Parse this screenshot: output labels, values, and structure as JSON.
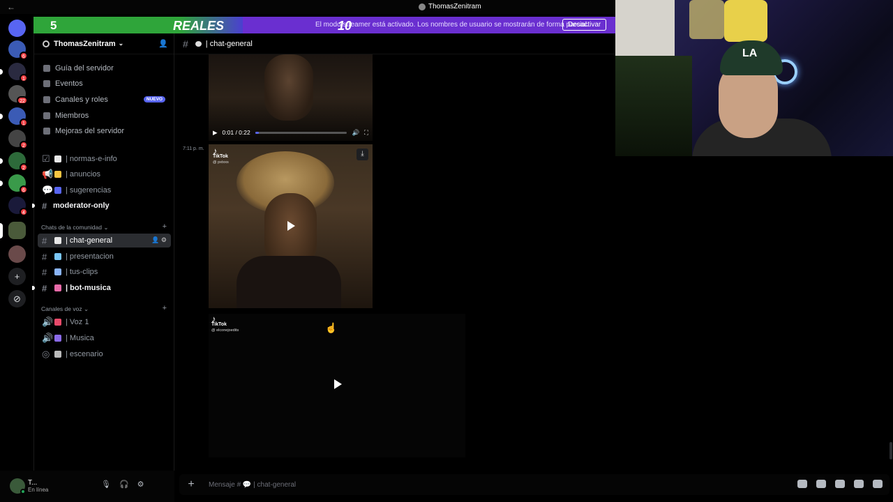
{
  "window": {
    "title": "ThomasZenitram",
    "back_glyph": "←"
  },
  "banner": {
    "left_number": "5",
    "word": "REALES",
    "overlay_number": "10",
    "message": "El modo streamer está activado. Los nombres de usuario se mostrarán de forma parcial.",
    "button": "Desactivar",
    "colors": {
      "green": "#2fa53a",
      "purple": "#6a2fd0"
    }
  },
  "server_list": {
    "items": [
      {
        "name": "discord-home",
        "badge": ""
      },
      {
        "name": "server-1",
        "badge": "6"
      },
      {
        "name": "server-2",
        "badge": "1"
      },
      {
        "name": "server-3",
        "badge": "22"
      },
      {
        "name": "server-4",
        "badge": "1"
      },
      {
        "name": "server-5",
        "badge": "2"
      },
      {
        "name": "server-6",
        "badge": "2"
      },
      {
        "name": "server-7",
        "badge": "6"
      },
      {
        "name": "server-8",
        "badge": "4"
      },
      {
        "name": "server-9",
        "badge": ""
      },
      {
        "name": "server-10",
        "badge": ""
      }
    ],
    "add_glyph": "+",
    "explore_glyph": "⊘"
  },
  "server": {
    "name": "ThomasZenitram",
    "chevron": "⌄",
    "nav": [
      {
        "label": "Guía del servidor",
        "icon": "guide-icon"
      },
      {
        "label": "Eventos",
        "icon": "calendar-icon"
      },
      {
        "label": "Canales y roles",
        "icon": "channels-icon",
        "tag": "NUEVO"
      },
      {
        "label": "Miembros",
        "icon": "members-icon"
      },
      {
        "label": "Mejoras del servidor",
        "icon": "boost-icon"
      }
    ],
    "channels_top": [
      {
        "label": "| normas-e-info",
        "emoji_color": "#e8e8e8"
      },
      {
        "label": "| anuncios",
        "emoji_color": "#f5c542"
      },
      {
        "label": "| sugerencias",
        "emoji_color": "#5865f2"
      },
      {
        "label": "moderator-only",
        "emoji_color": ""
      }
    ],
    "category_chat": "Chats de la comunidad",
    "channels_chat": [
      {
        "label": "| chat-general",
        "emoji_color": "#e8e8e8"
      },
      {
        "label": "| presentacion",
        "emoji_color": "#7ac6f5"
      },
      {
        "label": "| tus-clips",
        "emoji_color": "#8ab4f8"
      },
      {
        "label": "| bot-musica",
        "emoji_color": "#e86aa8"
      }
    ],
    "category_voice": "Canales de voz",
    "channels_voice": [
      {
        "label": "| Voz 1",
        "emoji_color": "#e84a6a"
      },
      {
        "label": "| Musica",
        "emoji_color": "#8a6ae8"
      },
      {
        "label": "| escenario",
        "emoji_color": "#bbbbbb"
      }
    ]
  },
  "user": {
    "name": "T...",
    "status": "En línea"
  },
  "chat": {
    "channel": "| chat-general",
    "timestamp": "7:11 p. m.",
    "video1": {
      "time": "0:01 / 0:22",
      "progress": 0.04
    },
    "video2": {
      "platform": "TikTok",
      "handle": "@ pxtxxs"
    },
    "video3": {
      "platform": "TikTok",
      "handle": "@ elconejoedits"
    },
    "placeholder": "Mensaje #",
    "placeholder_channel": "| chat-general"
  }
}
